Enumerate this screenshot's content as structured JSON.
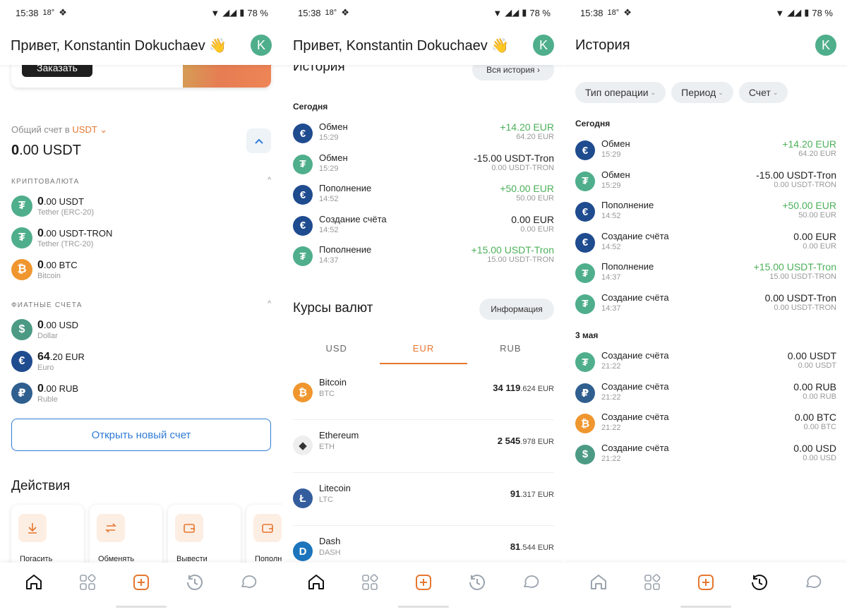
{
  "status": {
    "time": "15:38",
    "temp": "18",
    "deg_sign": "°",
    "battery": "78 %"
  },
  "phone1": {
    "header_title": "Привет, Konstantin Dokuchaev 👋",
    "avatar_letter": "K",
    "promo_button": "Заказать",
    "account_label": "Общий счет в",
    "account_currency": "USDT",
    "total_whole": "0",
    "total_rest": ".00 USDT",
    "crypto_section": "КРИПТОВАЛЮТА",
    "fiat_section": "ФИАТНЫЕ СЧЕТА",
    "crypto": [
      {
        "whole": "0",
        "rest": ".00 USDT",
        "sub": "Tether (ERC-20)",
        "icon": "tether-icon",
        "color": "#4fae8c",
        "glyph": "₮"
      },
      {
        "whole": "0",
        "rest": ".00 USDT-TRON",
        "sub": "Tether (TRC-20)",
        "icon": "tether-icon",
        "color": "#4fae8c",
        "glyph": "₮"
      },
      {
        "whole": "0",
        "rest": ".00 BTC",
        "sub": "Bitcoin",
        "icon": "bitcoin-icon",
        "color": "#f0962f",
        "glyph": "₿"
      }
    ],
    "fiat": [
      {
        "whole": "0",
        "rest": ".00 USD",
        "sub": "Dollar",
        "icon": "dollar-icon",
        "color": "#4c9a84",
        "glyph": "$"
      },
      {
        "whole": "64",
        "rest": ".20 EUR",
        "sub": "Euro",
        "icon": "euro-icon",
        "color": "#1f4b8f",
        "glyph": "€"
      },
      {
        "whole": "0",
        "rest": ".00 RUB",
        "sub": "Ruble",
        "icon": "ruble-icon",
        "color": "#2f5f8f",
        "glyph": "₽"
      }
    ],
    "open_account": "Открыть новый счет",
    "actions_title": "Действия",
    "actions": [
      {
        "label": "Погасить",
        "icon": "download-icon"
      },
      {
        "label": "Обменять",
        "icon": "exchange-icon"
      },
      {
        "label": "Вывести",
        "icon": "wallet-out-icon"
      },
      {
        "label": "Пополн",
        "icon": "wallet-in-icon"
      }
    ]
  },
  "phone2": {
    "header_title": "Привет, Konstantin Dokuchaev 👋",
    "avatar_letter": "K",
    "history_title": "История",
    "all_history": "Вся история",
    "today": "Сегодня",
    "transactions": [
      {
        "name": "Обмен",
        "time": "15:29",
        "amount": "+14.20 EUR",
        "sub": "64.20 EUR",
        "positive": true,
        "color": "#1f4b8f",
        "glyph": "€"
      },
      {
        "name": "Обмен",
        "time": "15:29",
        "amount": "-15.00 USDT-Tron",
        "sub": "0.00 USDT-TRON",
        "positive": false,
        "color": "#4fae8c",
        "glyph": "₮"
      },
      {
        "name": "Пополнение",
        "time": "14:52",
        "amount": "+50.00 EUR",
        "sub": "50.00 EUR",
        "positive": true,
        "color": "#1f4b8f",
        "glyph": "€"
      },
      {
        "name": "Создание счёта",
        "time": "14:52",
        "amount": "0.00 EUR",
        "sub": "0.00 EUR",
        "positive": false,
        "color": "#1f4b8f",
        "glyph": "€"
      },
      {
        "name": "Пополнение",
        "time": "14:37",
        "amount": "+15.00 USDT-Tron",
        "sub": "15.00 USDT-TRON",
        "positive": true,
        "color": "#4fae8c",
        "glyph": "₮"
      }
    ],
    "rates_title": "Курсы валют",
    "info_button": "Информация",
    "tabs": [
      "USD",
      "EUR",
      "RUB"
    ],
    "active_tab": "EUR",
    "rates": [
      {
        "name": "Bitcoin",
        "code": "BTC",
        "int": "34 119",
        "dec": ".624 EUR",
        "color": "#f0962f",
        "glyph": "₿"
      },
      {
        "name": "Ethereum",
        "code": "ETH",
        "int": "2 545",
        "dec": ".978 EUR",
        "color": "#eeeeee",
        "glyph": "◆"
      },
      {
        "name": "Litecoin",
        "code": "LTC",
        "int": "91",
        "dec": ".317 EUR",
        "color": "#345d9d",
        "glyph": "Ł"
      },
      {
        "name": "Dash",
        "code": "DASH",
        "int": "81",
        "dec": ".544 EUR",
        "color": "#1c75bc",
        "glyph": "D"
      }
    ]
  },
  "phone3": {
    "header_title": "История",
    "avatar_letter": "K",
    "filters": [
      "Тип операции",
      "Период",
      "Счет"
    ],
    "today": "Сегодня",
    "today_tx": [
      {
        "name": "Обмен",
        "time": "15:29",
        "amount": "+14.20 EUR",
        "sub": "64.20 EUR",
        "positive": true,
        "color": "#1f4b8f",
        "glyph": "€"
      },
      {
        "name": "Обмен",
        "time": "15:29",
        "amount": "-15.00 USDT-Tron",
        "sub": "0.00 USDT-TRON",
        "positive": false,
        "color": "#4fae8c",
        "glyph": "₮"
      },
      {
        "name": "Пополнение",
        "time": "14:52",
        "amount": "+50.00 EUR",
        "sub": "50.00 EUR",
        "positive": true,
        "color": "#1f4b8f",
        "glyph": "€"
      },
      {
        "name": "Создание счёта",
        "time": "14:52",
        "amount": "0.00 EUR",
        "sub": "0.00 EUR",
        "positive": false,
        "color": "#1f4b8f",
        "glyph": "€"
      },
      {
        "name": "Пополнение",
        "time": "14:37",
        "amount": "+15.00 USDT-Tron",
        "sub": "15.00 USDT-TRON",
        "positive": true,
        "color": "#4fae8c",
        "glyph": "₮"
      },
      {
        "name": "Создание счёта",
        "time": "14:37",
        "amount": "0.00 USDT-Tron",
        "sub": "0.00 USDT-TRON",
        "positive": false,
        "color": "#4fae8c",
        "glyph": "₮"
      }
    ],
    "may": "3 мая",
    "may_tx": [
      {
        "name": "Создание счёта",
        "time": "21:22",
        "amount": "0.00 USDT",
        "sub": "0.00 USDT",
        "positive": false,
        "color": "#4fae8c",
        "glyph": "₮"
      },
      {
        "name": "Создание счёта",
        "time": "21:22",
        "amount": "0.00 RUB",
        "sub": "0.00 RUB",
        "positive": false,
        "color": "#2f5f8f",
        "glyph": "₽"
      },
      {
        "name": "Создание счёта",
        "time": "21:22",
        "amount": "0.00 BTC",
        "sub": "0.00 BTC",
        "positive": false,
        "color": "#f0962f",
        "glyph": "₿"
      },
      {
        "name": "Создание счёта",
        "time": "21:22",
        "amount": "0.00 USD",
        "sub": "0.00 USD",
        "positive": false,
        "color": "#4c9a84",
        "glyph": "$"
      }
    ]
  },
  "nav": [
    "home-icon",
    "apps-icon",
    "add-icon",
    "history-icon",
    "chat-icon"
  ],
  "colors": {
    "accent": "#e6762f",
    "link": "#2f7bd6",
    "positive": "#4db05a",
    "avatar": "#4fae8c"
  }
}
